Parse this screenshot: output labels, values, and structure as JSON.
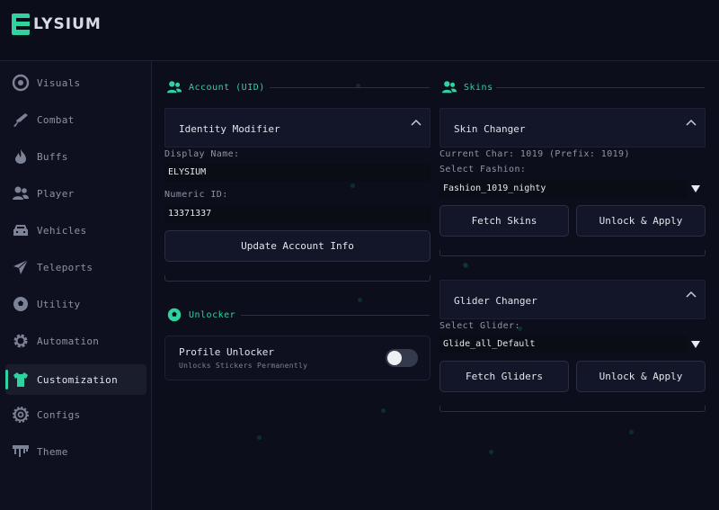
{
  "app": {
    "title": "ELYSIUM",
    "logo_letter": "E",
    "logo_rest": "LYSIUM"
  },
  "colors": {
    "accent": "#2ed3a0",
    "background": "#0c0e1c",
    "panel": "#131628",
    "input": "#0a0c16"
  },
  "sidebar": {
    "items": [
      {
        "label": "Visuals",
        "icon": "eye-icon"
      },
      {
        "label": "Combat",
        "icon": "gun-icon"
      },
      {
        "label": "Buffs",
        "icon": "flame-icon"
      },
      {
        "label": "Player",
        "icon": "users-icon"
      },
      {
        "label": "Vehicles",
        "icon": "car-icon"
      },
      {
        "label": "Teleports",
        "icon": "paper-plane-icon"
      },
      {
        "label": "Utility",
        "icon": "ball-icon"
      },
      {
        "label": "Automation",
        "icon": "gear-icon"
      },
      {
        "label": "Customization",
        "icon": "shirt-icon",
        "active": true
      },
      {
        "label": "Configs",
        "icon": "cog-icon"
      },
      {
        "label": "Theme",
        "icon": "paint-drip-icon"
      }
    ]
  },
  "account": {
    "section_title": "Account (UID)",
    "card_title": "Identity Modifier",
    "display_name_label": "Display Name:",
    "display_name_value": "ELYSIUM",
    "numeric_id_label": "Numeric ID:",
    "numeric_id_value": "13371337",
    "update_button": "Update Account Info"
  },
  "unlocker": {
    "section_title": "Unlocker",
    "item_title": "Profile Unlocker",
    "item_subtitle": "Unlocks Stickers Permanently",
    "toggle_on": false
  },
  "skins": {
    "section_title": "Skins",
    "skin_changer": {
      "card_title": "Skin Changer",
      "current_char": "Current Char: 1019 (Prefix: 1019)",
      "select_label": "Select Fashion:",
      "selected_value": "Fashion_1019_nighty",
      "fetch_button": "Fetch Skins",
      "apply_button": "Unlock & Apply"
    },
    "glider_changer": {
      "card_title": "Glider Changer",
      "select_label": "Select Glider:",
      "selected_value": "Glide_all_Default",
      "fetch_button": "Fetch Gliders",
      "apply_button": "Unlock & Apply"
    }
  }
}
